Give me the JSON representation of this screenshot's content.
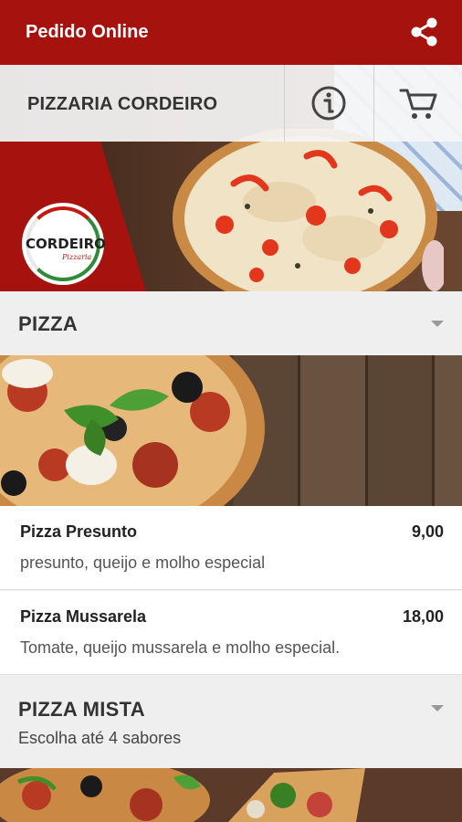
{
  "appbar": {
    "title": "Pedido Online",
    "share_icon": "share-icon"
  },
  "store": {
    "name": "PIZZARIA CORDEIRO",
    "info_icon": "info-icon",
    "cart_icon": "cart-icon"
  },
  "logo": {
    "word": "CORDEIRO",
    "sub": "Pizzaria"
  },
  "categories": [
    {
      "name": "PIZZA",
      "items": [
        {
          "name": "Pizza Presunto",
          "price": "9,00",
          "description": "presunto, queijo e molho especial"
        },
        {
          "name": "Pizza Mussarela",
          "price": "18,00",
          "description": "Tomate, queijo mussarela e molho especial."
        }
      ]
    },
    {
      "name": "PIZZA MISTA",
      "hint": "Escolha até 4 sabores"
    }
  ],
  "colors": {
    "brand": "#a6120e",
    "background": "#eeeeee"
  }
}
